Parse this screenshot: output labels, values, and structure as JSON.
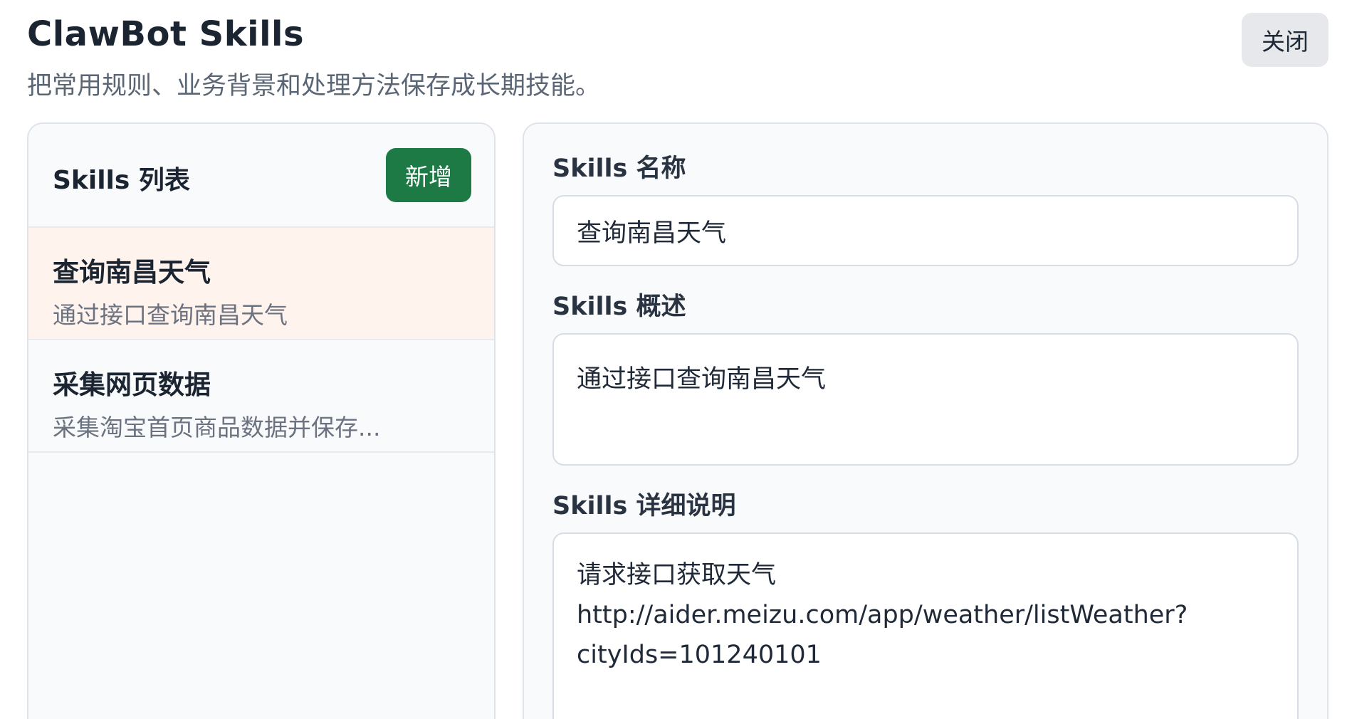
{
  "header": {
    "title": "ClawBot Skills",
    "subtitle": "把常用规则、业务背景和处理方法保存成长期技能。",
    "close_label": "关闭"
  },
  "list": {
    "title": "Skills 列表",
    "add_label": "新增",
    "items": [
      {
        "name": "查询南昌天气",
        "desc": "通过接口查询南昌天气",
        "active": true
      },
      {
        "name": "采集网页数据",
        "desc": "采集淘宝首页商品数据并保存...",
        "active": false
      }
    ]
  },
  "editor": {
    "name_label": "Skills 名称",
    "name_value": "查询南昌天气",
    "summary_label": "Skills 概述",
    "summary_value": "通过接口查询南昌天气",
    "detail_label": "Skills 详细说明",
    "detail_value": "请求接口获取天气\nhttp://aider.meizu.com/app/weather/listWeather?\ncityIds=101240101"
  },
  "colors": {
    "primary": "#1d7a45",
    "active_item_bg": "#fff3ee",
    "panel_bg": "#f8fafc",
    "border": "#dfe3ea"
  }
}
